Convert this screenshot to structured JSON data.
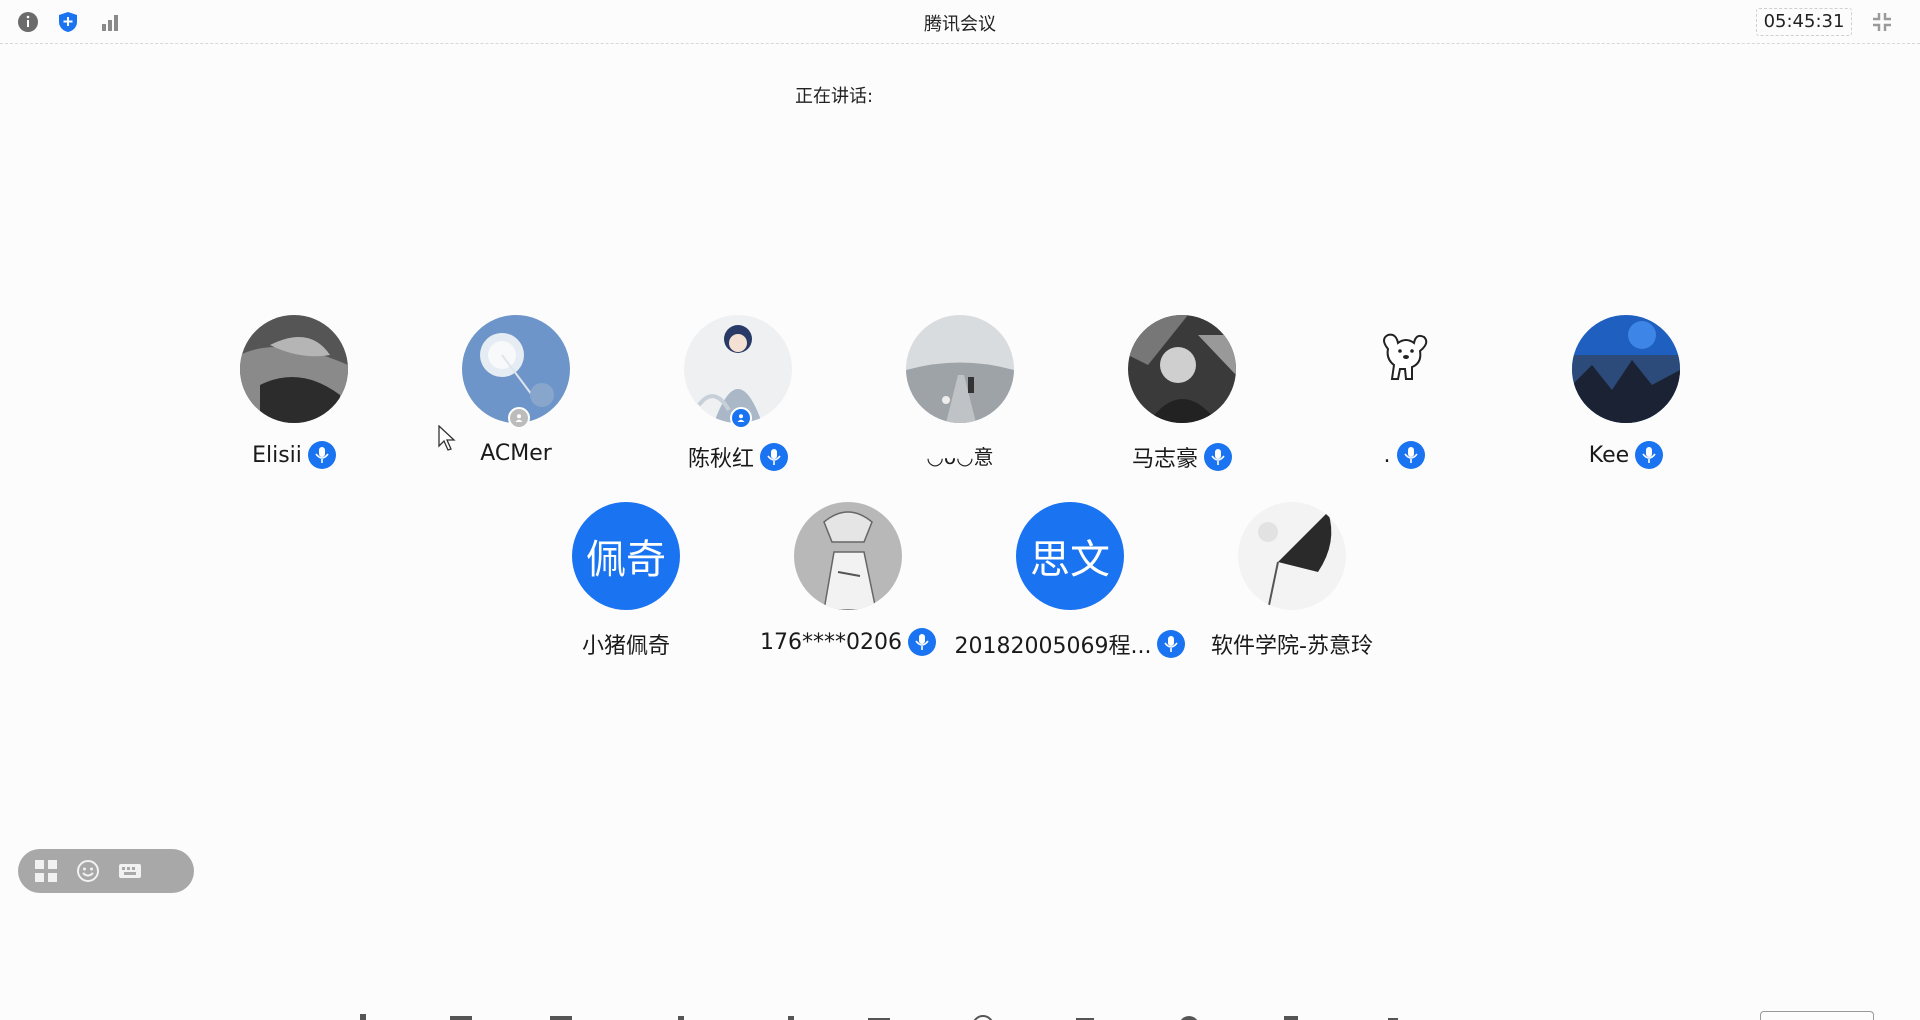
{
  "window": {
    "title": "腾讯会议",
    "clock": "05:45:31",
    "icons": [
      "info-icon",
      "shield-icon",
      "signal-icon",
      "fullscreen-exit-icon"
    ]
  },
  "meeting": {
    "speaking_label": "正在讲话:"
  },
  "participants": [
    {
      "name": "Elisii",
      "mic": true,
      "avatar": "photo-dark"
    },
    {
      "name": "ACMer",
      "mic": false,
      "avatar": "photo-dandelion",
      "badge": "gray"
    },
    {
      "name": "陈秋红",
      "mic": true,
      "avatar": "photo-anime",
      "badge": "blue"
    },
    {
      "name": "◡ᴗ◡意",
      "mic": false,
      "avatar": "photo-road"
    },
    {
      "name": "马志豪",
      "mic": true,
      "avatar": "photo-person"
    },
    {
      "name": ".",
      "mic": true,
      "avatar": "dog-sticker"
    },
    {
      "name": "Kee",
      "mic": true,
      "avatar": "photo-blue"
    },
    {
      "name": "小猪佩奇",
      "mic": false,
      "avatar_text": "佩奇"
    },
    {
      "name": "176****0206",
      "mic": true,
      "avatar": "photo-sketch"
    },
    {
      "name": "20182005069程...",
      "mic": true,
      "avatar_text": "思文"
    },
    {
      "name": "软件学院-苏意玲",
      "mic": false,
      "avatar": "photo-umbrella"
    }
  ],
  "colors": {
    "accent": "#1a73f0",
    "background": "#fcfcfc"
  }
}
